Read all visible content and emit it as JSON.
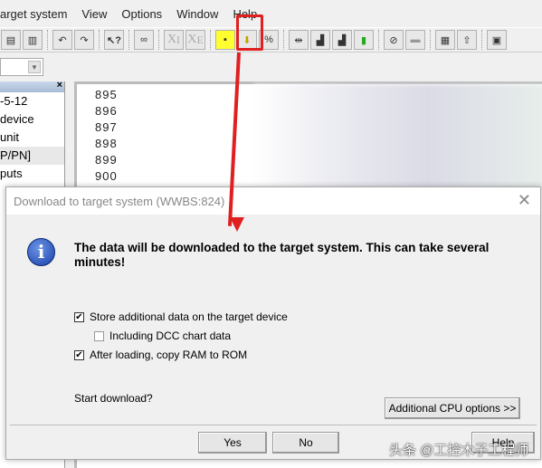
{
  "menu": [
    "arget system",
    "View",
    "Options",
    "Window",
    "Help"
  ],
  "toolbar": {
    "icons": [
      "copy-icon",
      "paste-icon",
      "undo-icon",
      "redo-icon",
      "help-icon",
      "link-icon",
      "xi-icon",
      "xe-icon",
      "network-icon",
      "download-icon",
      "compare-icon",
      "split-icon",
      "load-icon",
      "upload-icon",
      "module-icon",
      "diagnose-icon",
      "disabled-icon",
      "config-icon",
      "export-icon",
      "monitor-icon"
    ],
    "highlighted": "download-icon",
    "highlight_color": "#e02020"
  },
  "tree": {
    "items": [
      "-5-12",
      "device",
      "unit",
      "P/PN]",
      "puts"
    ]
  },
  "editor": {
    "lines": [
      "895",
      "896",
      "897",
      "898",
      "899",
      "900"
    ]
  },
  "dialog": {
    "title": "Download to target system (WWBS:824)",
    "message": "The data will be downloaded to the target system. This can take several minutes!",
    "options": [
      {
        "label": "Store additional data on the target device",
        "checked": true
      },
      {
        "label": "Including DCC chart data",
        "checked": false
      },
      {
        "label": "After loading, copy RAM to ROM",
        "checked": true
      }
    ],
    "question": "Start download?",
    "cpu_options": "Additional CPU options >>",
    "yes": "Yes",
    "no": "No",
    "help": "Help"
  },
  "watermark": "头条 @工控木子工程师"
}
